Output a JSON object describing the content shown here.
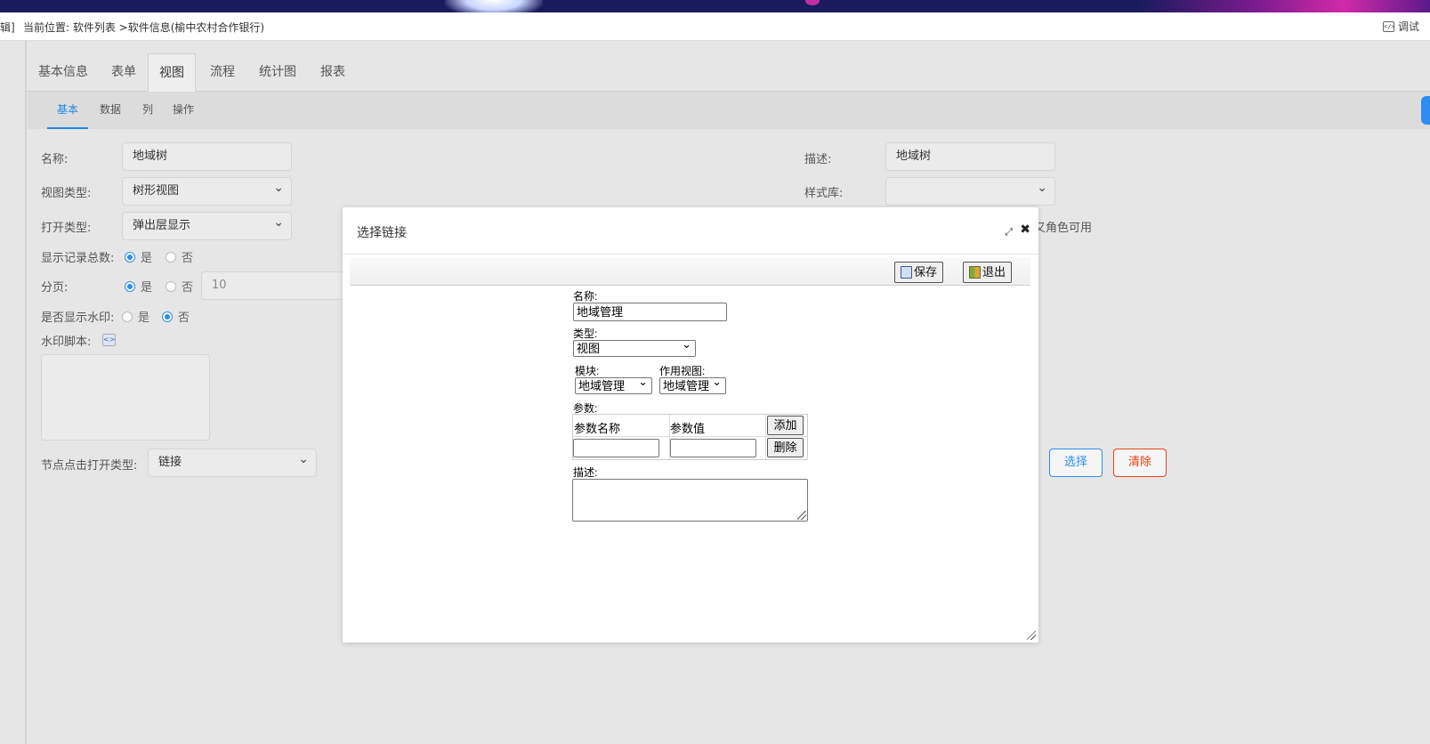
{
  "breadcrumb": {
    "prefix": "辑]",
    "text": "当前位置: 软件列表 >软件信息(榆中农村合作银行)",
    "debug_label": "调试"
  },
  "tabs": [
    {
      "label": "基本信息"
    },
    {
      "label": "表单"
    },
    {
      "label": "视图",
      "active": true
    },
    {
      "label": "流程"
    },
    {
      "label": "统计图"
    },
    {
      "label": "报表"
    }
  ],
  "subtabs": [
    {
      "label": "基本",
      "active": true
    },
    {
      "label": "数据"
    },
    {
      "label": "列"
    },
    {
      "label": "操作"
    }
  ],
  "form": {
    "name_label": "名称:",
    "name_value": "地域树",
    "viewtype_label": "视图类型:",
    "viewtype_value": "树形视图",
    "opentype_label": "打开类型:",
    "opentype_value": "弹出层显示",
    "showcount_label": "显示记录总数:",
    "yes": "是",
    "no": "否",
    "paging_label": "分页:",
    "paging_size": "10",
    "watermark_label": "是否显示水印:",
    "watermark_script_label": "水印脚本:",
    "node_click_label": "节点点击打开类型:",
    "node_click_value": "链接",
    "desc_label": "描述:",
    "desc_value": "地域树",
    "style_label": "样式库:",
    "style_value": "",
    "role_text": "又角色可用",
    "select_button": "选择",
    "clear_button": "清除"
  },
  "modal": {
    "title": "选择链接",
    "save_label": "保存",
    "exit_label": "退出",
    "name_label": "名称:",
    "name_value": "地域管理",
    "type_label": "类型:",
    "type_value": "视图",
    "module_label": "模块:",
    "module_value": "地域管理",
    "targetview_label": "作用视图:",
    "targetview_value": "地域管理",
    "params_label": "参数:",
    "param_name_header": "参数名称",
    "param_value_header": "参数值",
    "add_label": "添加",
    "delete_label": "删除",
    "desc_label": "描述:"
  },
  "colors": {
    "accent": "#2d8cf0",
    "danger": "#ed4014",
    "banner": "#1a1b5c"
  }
}
